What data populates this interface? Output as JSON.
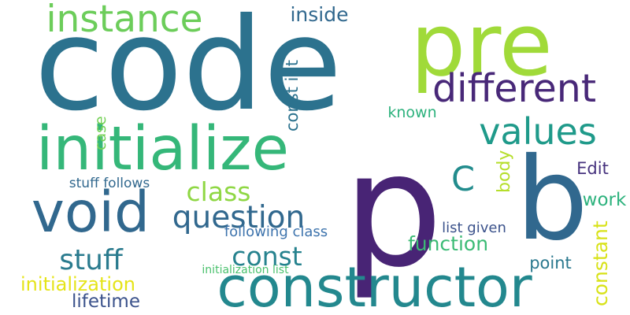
{
  "words": [
    {
      "text": "code",
      "color": "#2c728e"
    },
    {
      "text": "pre",
      "color": "#a0da39"
    },
    {
      "text": "p",
      "color": "#482475"
    },
    {
      "text": "constructor",
      "color": "#23888e"
    },
    {
      "text": "initialize",
      "color": "#35b779"
    },
    {
      "text": "void",
      "color": "#31688e"
    },
    {
      "text": "b",
      "color": "#31688e"
    },
    {
      "text": "instance",
      "color": "#6ccd5a"
    },
    {
      "text": "different",
      "color": "#482878"
    },
    {
      "text": "values",
      "color": "#1f9a8a"
    },
    {
      "text": "question",
      "color": "#31688e"
    },
    {
      "text": "class",
      "color": "#8fd744"
    },
    {
      "text": "stuff",
      "color": "#2a7b8e"
    },
    {
      "text": "const",
      "color": "#26828e"
    },
    {
      "text": "C",
      "color": "#228c8d"
    },
    {
      "text": "initialization",
      "color": "#e5e419"
    },
    {
      "text": "lifetime",
      "color": "#3b528b"
    },
    {
      "text": "function",
      "color": "#3bbb75"
    },
    {
      "text": "inside",
      "color": "#31688e"
    },
    {
      "text": "known",
      "color": "#2db27d"
    },
    {
      "text": "Edit",
      "color": "#46327e"
    },
    {
      "text": "work",
      "color": "#2db27d"
    },
    {
      "text": "point",
      "color": "#2a788e"
    },
    {
      "text": "stuff follows",
      "color": "#31688e"
    },
    {
      "text": "following class",
      "color": "#3e74ad"
    },
    {
      "text": "list given",
      "color": "#3b528b"
    },
    {
      "text": "initialization list",
      "color": "#4ac16d"
    },
    {
      "text": "const int",
      "color": "#2c728e"
    },
    {
      "text": "case",
      "color": "#73d055"
    },
    {
      "text": "body",
      "color": "#b5de2b"
    },
    {
      "text": "constant",
      "color": "#d8e219"
    }
  ]
}
